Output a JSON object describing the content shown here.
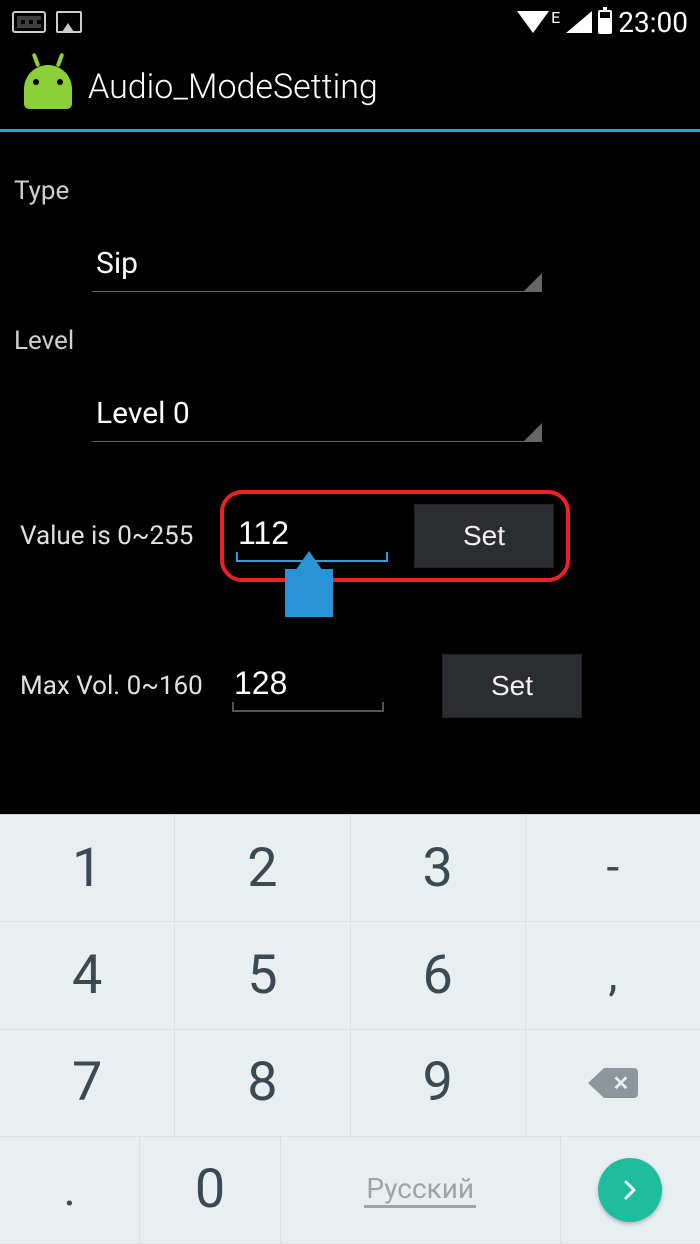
{
  "status": {
    "e_indicator": "E",
    "time": "23:00"
  },
  "actionbar": {
    "title": "Audio_ModeSetting"
  },
  "labels": {
    "type": "Type",
    "level": "Level"
  },
  "spinners": {
    "type_value": "Sip",
    "level_value": "Level 0"
  },
  "row1": {
    "label": "Value is 0~255",
    "value": "112",
    "button": "Set"
  },
  "row2": {
    "label": "Max Vol. 0~160",
    "value": "128",
    "button": "Set"
  },
  "keyboard": {
    "k1": "1",
    "k2": "2",
    "k3": "3",
    "kdash": "-",
    "k4": "4",
    "k5": "5",
    "k6": "6",
    "kcomma": ",",
    "k7": "7",
    "k8": "8",
    "k9": "9",
    "kdot": ".",
    "k0": "0",
    "lang": "Русский"
  }
}
